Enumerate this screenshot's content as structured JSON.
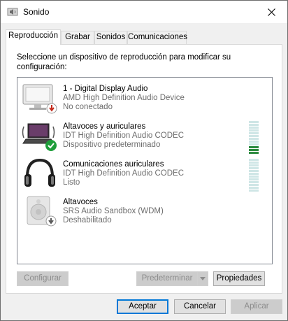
{
  "window": {
    "title": "Sonido",
    "app_icon": "speaker-icon",
    "close_icon": "close-icon"
  },
  "tabs": [
    {
      "label": "Reproducción",
      "active": true
    },
    {
      "label": "Grabar",
      "active": false
    },
    {
      "label": "Sonidos",
      "active": false
    },
    {
      "label": "Comunicaciones",
      "active": false
    }
  ],
  "instructions": "Seleccione un dispositivo de reproducción para modificar su configuración:",
  "devices": [
    {
      "name": "1 - Digital Display Audio",
      "description": "AMD High Definition Audio Device",
      "status": "No conectado",
      "icon": "monitor-icon",
      "badge": "disconnected-badge-icon"
    },
    {
      "name": "Altavoces y auriculares",
      "description": "IDT High Definition Audio CODEC",
      "status": "Dispositivo predeterminado",
      "icon": "laptop-speakers-icon",
      "badge": "default-check-icon",
      "meter_level": 0.25
    },
    {
      "name": "Comunicaciones auriculares",
      "description": "IDT High Definition Audio CODEC",
      "status": "Listo",
      "icon": "headphones-icon",
      "meter_level": 0
    },
    {
      "name": "Altavoces",
      "description": "SRS Audio Sandbox (WDM)",
      "status": "Deshabilitado",
      "icon": "speaker-icon",
      "badge": "disabled-badge-icon"
    }
  ],
  "buttons": {
    "configure": "Configurar",
    "set_default": "Predeterminar",
    "properties": "Propiedades",
    "ok": "Aceptar",
    "cancel": "Cancelar",
    "apply": "Aplicar"
  },
  "colors": {
    "accent": "#0078d7",
    "meter_on": "#2b8a3e",
    "meter_off": "#cfe6e6",
    "check_green": "#1e9e3a",
    "badge_red": "#c42b1c"
  }
}
